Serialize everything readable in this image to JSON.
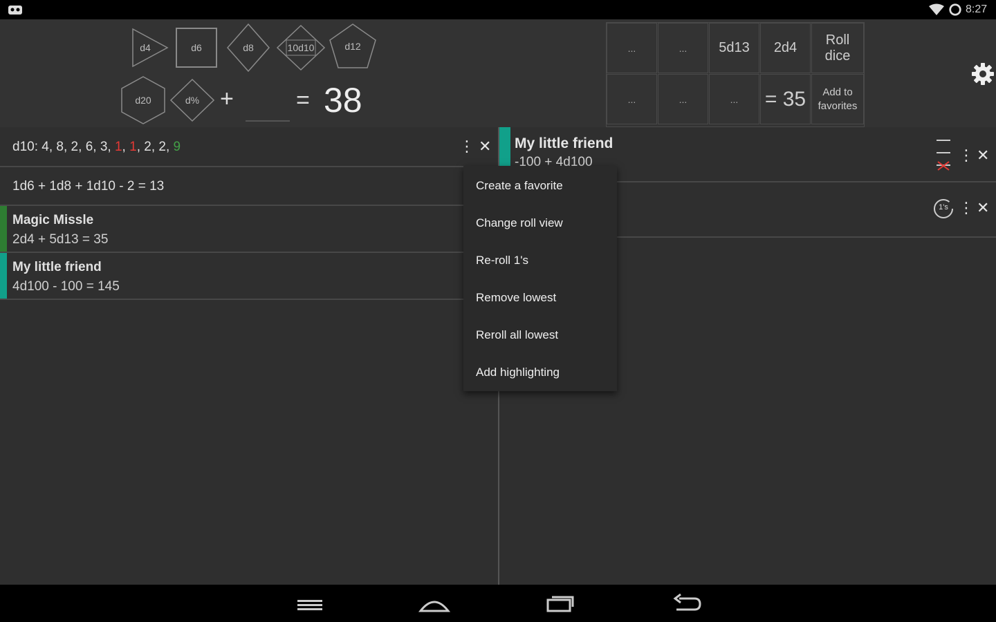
{
  "status_bar": {
    "time": "8:27"
  },
  "dice_buttons": [
    "d4",
    "d6",
    "d8",
    "10d10",
    "d12",
    "d20",
    "d%"
  ],
  "calculator": {
    "plus": "+",
    "equals": "=",
    "total": "38",
    "modifier_value": ""
  },
  "favorites_grid": {
    "row1": [
      "...",
      "...",
      "5d13",
      "2d4",
      "Roll dice"
    ],
    "row2": [
      "...",
      "...",
      "...",
      "= 35",
      "Add to favorites"
    ]
  },
  "left_list": {
    "row1": {
      "prefix": "d10: ",
      "values": [
        {
          "text": "4",
          "color": "#e0e0e0"
        },
        {
          "text": "8",
          "color": "#e0e0e0"
        },
        {
          "text": "2",
          "color": "#e0e0e0"
        },
        {
          "text": "6",
          "color": "#e0e0e0"
        },
        {
          "text": "3",
          "color": "#e0e0e0"
        },
        {
          "text": "1",
          "color": "#e53935"
        },
        {
          "text": "1",
          "color": "#e53935"
        },
        {
          "text": "2",
          "color": "#e0e0e0"
        },
        {
          "text": "2",
          "color": "#e0e0e0"
        },
        {
          "text": "9",
          "color": "#43a047"
        }
      ]
    },
    "row2": {
      "text": "1d6 + 1d8 + 1d10 - 2 = 13"
    },
    "row3": {
      "name": "Magic Missle",
      "formula": "2d4 + 5d13 = 35",
      "accent": "#2e7d32"
    },
    "row4": {
      "name": "My little friend",
      "formula": "4d100 - 100 = 145",
      "accent": "#11a08a"
    }
  },
  "right_list": {
    "row1": {
      "name": "My little friend",
      "formula": "-100 + 4d100",
      "accent": "#11a08a"
    }
  },
  "popup_menu": [
    "Create a favorite",
    "Change roll view",
    "Re-roll 1's",
    "Remove lowest",
    "Reroll all lowest",
    "Add highlighting"
  ],
  "icons": {
    "close": "✕",
    "overflow": "⋮",
    "reroll_badge": "1's"
  },
  "colors": {
    "accent_teal": "#11a08a",
    "accent_green": "#2e7d32",
    "low_roll": "#e53935",
    "high_roll": "#43a047"
  }
}
